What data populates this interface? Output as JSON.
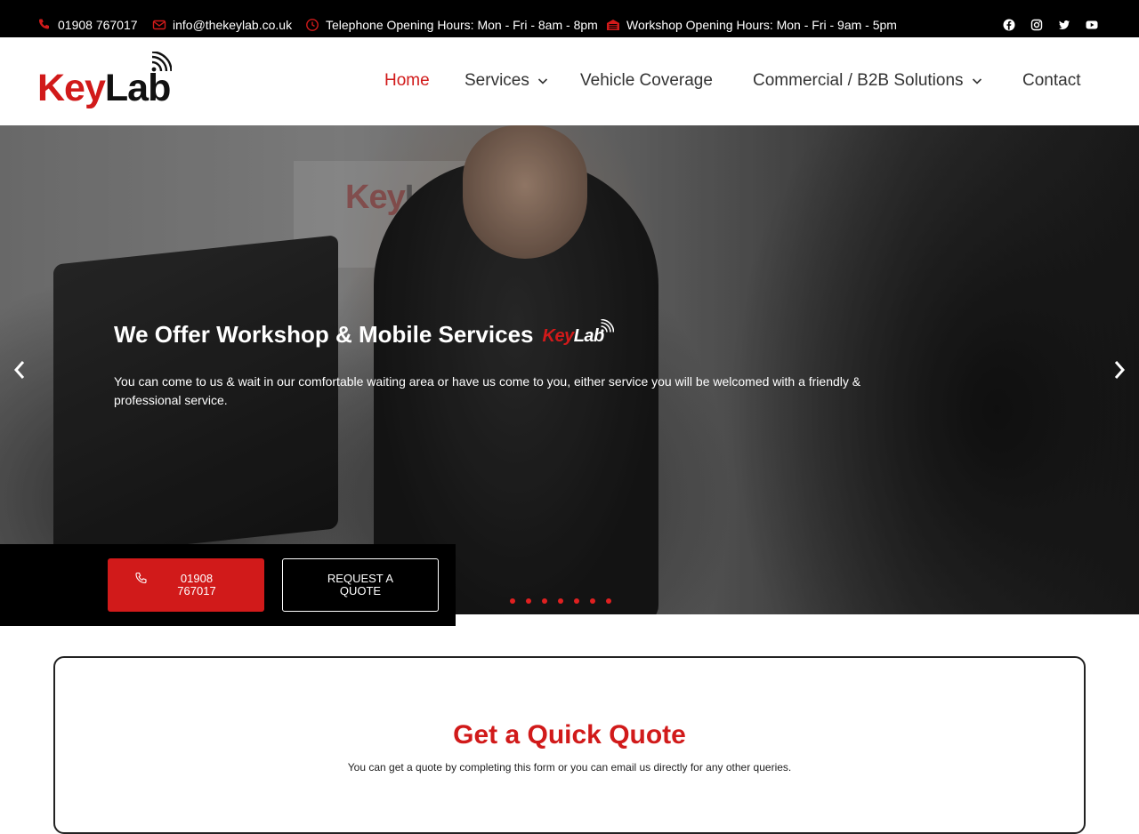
{
  "topbar": {
    "phone": "01908 767017",
    "email": "info@thekeylab.co.uk",
    "telephone_hours": "Telephone Opening Hours: Mon - Fri - 8am - 8pm",
    "workshop_hours": "Workshop Opening Hours: Mon - Fri - 9am - 5pm",
    "socials": [
      "facebook-icon",
      "instagram-icon",
      "twitter-icon",
      "youtube-icon"
    ]
  },
  "logo": {
    "key": "Key",
    "lab": "Lab"
  },
  "nav": {
    "home": "Home",
    "services": "Services",
    "vehicle_coverage": "Vehicle Coverage",
    "commercial": "Commercial / B2B Solutions",
    "contact": "Contact"
  },
  "hero": {
    "title": "We Offer Workshop & Mobile Services",
    "mini_logo_key": "Key",
    "mini_logo_lab": "Lab",
    "wall_logo_key": "Key",
    "wall_logo_lab": "Lab",
    "subtitle": "You can come to us & wait in our comfortable waiting area or have us come to you, either service you will be welcomed with a friendly & professional service.",
    "slide_count": 7
  },
  "cta": {
    "call_label": "01908 767017",
    "quote_label": "REQUEST A QUOTE"
  },
  "quote": {
    "title": "Get a Quick Quote",
    "subtitle": "You can get a quote by completing this form or you can email us directly for any other queries."
  },
  "colors": {
    "brand_red": "#d11a1a",
    "dark": "#000000"
  }
}
